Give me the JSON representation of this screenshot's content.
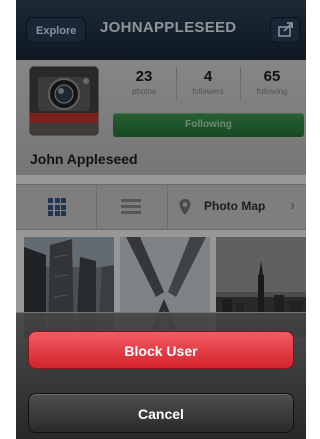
{
  "navbar": {
    "explore_label": "Explore",
    "title": "JOHNAPPLESEED",
    "share_icon": "share-icon"
  },
  "profile": {
    "stats": [
      {
        "value": "23",
        "label": "photos"
      },
      {
        "value": "4",
        "label": "followers"
      },
      {
        "value": "65",
        "label": "following"
      }
    ],
    "follow_label": "Following",
    "name": "John Appleseed"
  },
  "tabs": {
    "grid_icon": "grid-icon",
    "list_icon": "list-icon",
    "map_label": "Photo Map"
  },
  "action_sheet": {
    "block_label": "Block User",
    "cancel_label": "Cancel",
    "block_color": "#e03a42"
  }
}
